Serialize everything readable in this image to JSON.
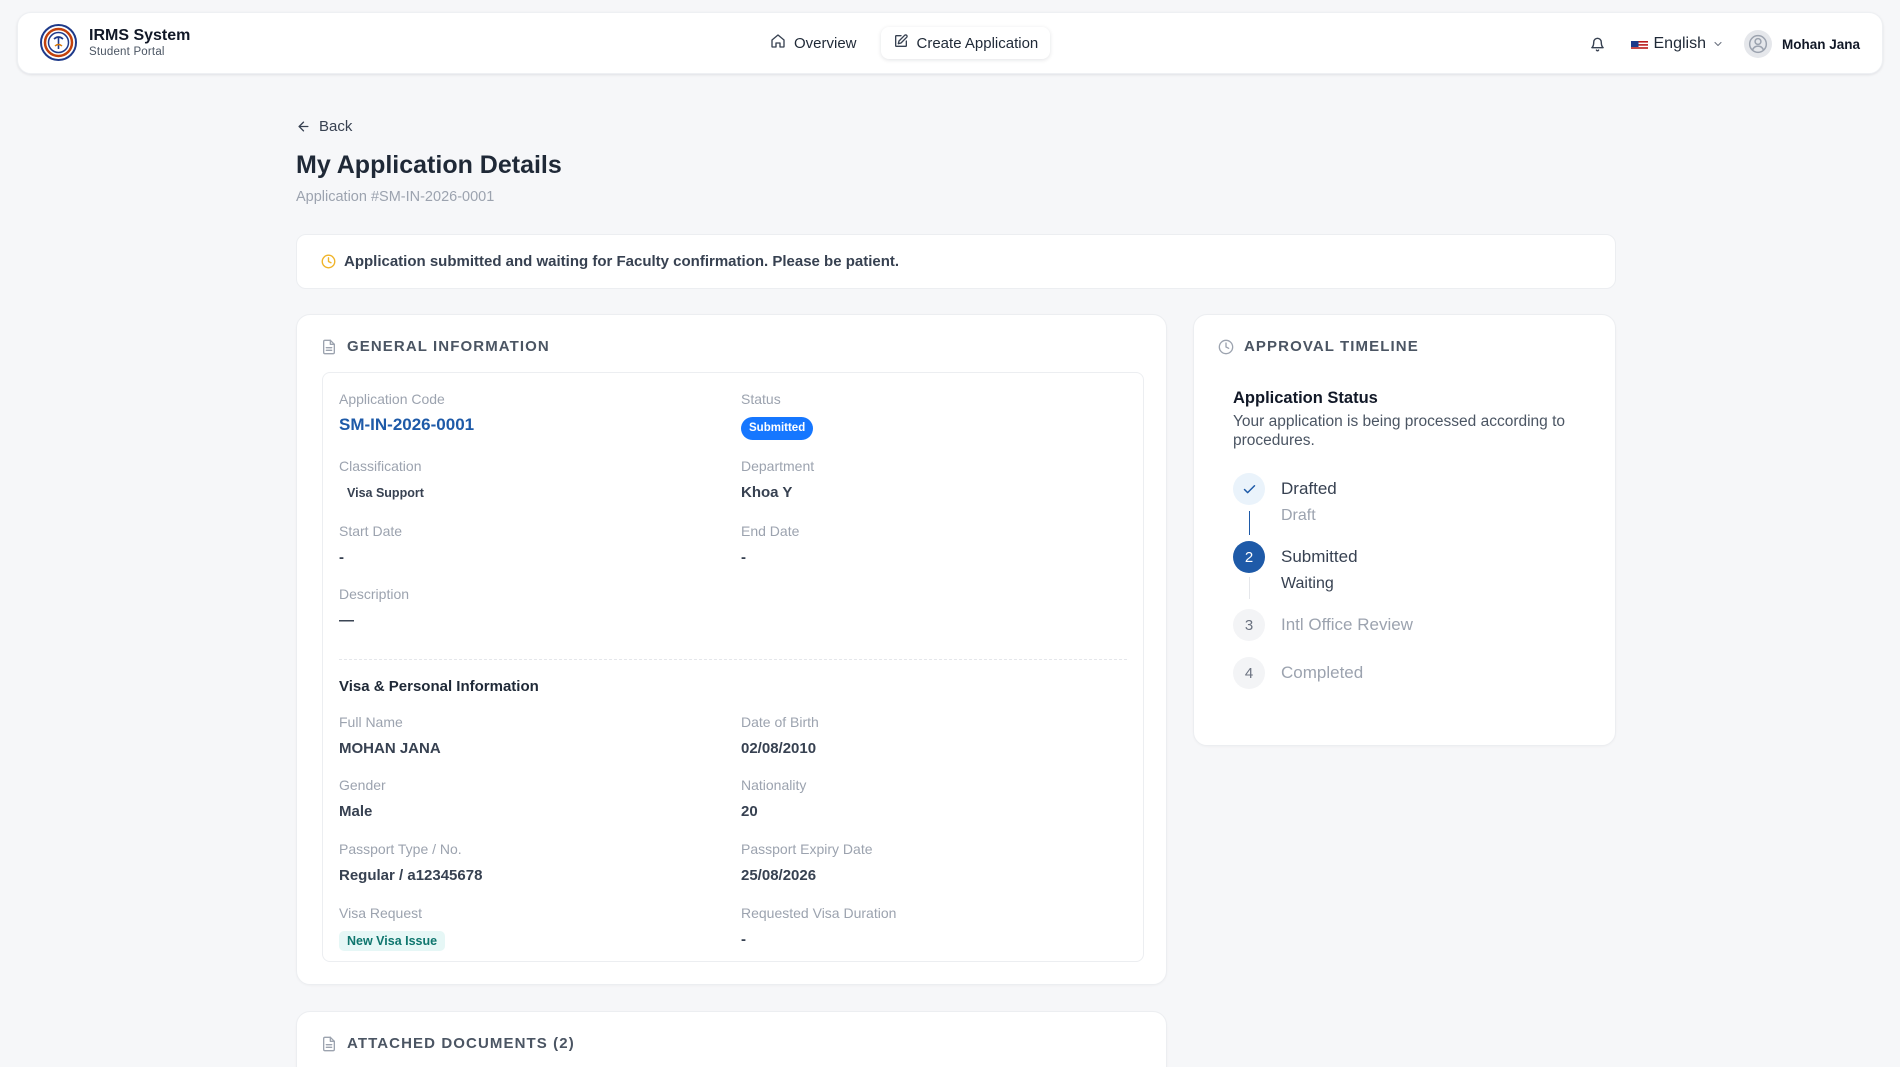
{
  "header": {
    "brand_title": "IRMS System",
    "brand_subtitle": "Student Portal",
    "nav": [
      {
        "label": "Overview",
        "icon": "home-icon"
      },
      {
        "label": "Create Application",
        "icon": "edit-icon"
      }
    ],
    "language": "English",
    "user_name": "Mohan Jana"
  },
  "page": {
    "back_label": "Back",
    "title": "My Application Details",
    "application_number": "Application #SM-IN-2026-0001",
    "notice": "Application submitted and waiting for Faculty confirmation. Please be patient."
  },
  "general": {
    "title": "GENERAL INFORMATION",
    "application_code_label": "Application Code",
    "application_code": "SM-IN-2026-0001",
    "status_label": "Status",
    "status": "Submitted",
    "classification_label": "Classification",
    "classification": "Visa Support",
    "department_label": "Department",
    "department": "Khoa Y",
    "start_date_label": "Start Date",
    "start_date": "-",
    "end_date_label": "End Date",
    "end_date": "-",
    "description_label": "Description",
    "description": "—",
    "visa_section_title": "Visa & Personal Information",
    "full_name_label": "Full Name",
    "full_name": "MOHAN JANA",
    "dob_label": "Date of Birth",
    "dob": "02/08/2010",
    "gender_label": "Gender",
    "gender": "Male",
    "nationality_label": "Nationality",
    "nationality": "20",
    "passport_label": "Passport Type / No.",
    "passport": "Regular / a12345678",
    "passport_expiry_label": "Passport Expiry Date",
    "passport_expiry": "25/08/2026",
    "visa_request_label": "Visa Request",
    "visa_request": "New Visa Issue",
    "visa_duration_label": "Requested Visa Duration",
    "visa_duration": "-"
  },
  "timeline": {
    "title": "APPROVAL TIMELINE",
    "status_title": "Application Status",
    "status_desc": "Your application is being processed according to procedures.",
    "steps": [
      {
        "number": "",
        "label": "Drafted",
        "sub": "Draft",
        "state": "done"
      },
      {
        "number": "2",
        "label": "Submitted",
        "sub": "Waiting",
        "state": "active"
      },
      {
        "number": "3",
        "label": "Intl Office Review",
        "sub": "",
        "state": "pending"
      },
      {
        "number": "4",
        "label": "Completed",
        "sub": "",
        "state": "pending"
      }
    ]
  },
  "documents": {
    "title": "ATTACHED DOCUMENTS (2)"
  },
  "colors": {
    "accent": "#1e5aa8",
    "status_badge": "#1677ff",
    "notice_icon": "#f0b429"
  }
}
